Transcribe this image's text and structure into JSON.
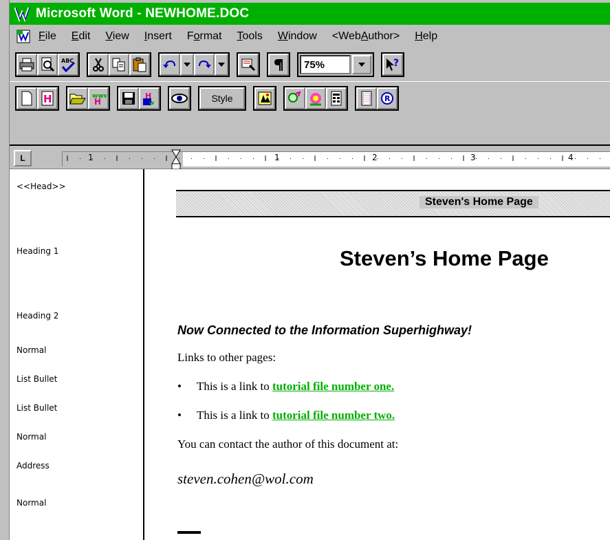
{
  "window": {
    "title": "Microsoft Word - NEWHOME.DOC",
    "title_color": "#00b000"
  },
  "menu": {
    "items": [
      {
        "prefix": "",
        "u": "F",
        "rest": "ile"
      },
      {
        "prefix": "",
        "u": "E",
        "rest": "dit"
      },
      {
        "prefix": "",
        "u": "V",
        "rest": "iew"
      },
      {
        "prefix": "",
        "u": "I",
        "rest": "nsert"
      },
      {
        "prefix": "F",
        "u": "o",
        "rest": "rmat"
      },
      {
        "prefix": "",
        "u": "T",
        "rest": "ools"
      },
      {
        "prefix": "",
        "u": "W",
        "rest": "indow"
      },
      {
        "prefix": "<Web",
        "u": "A",
        "rest": "uthor>"
      },
      {
        "prefix": "",
        "u": "H",
        "rest": "elp"
      }
    ]
  },
  "toolbar": {
    "zoom_value": "75%",
    "style_label": "Style",
    "icons": [
      "print-icon",
      "print-preview-icon",
      "spelling-icon",
      "cut-icon",
      "copy-icon",
      "paste-icon",
      "undo-icon",
      "redo-icon",
      "format-painter-icon",
      "show-paragraph-icon",
      "help-pointer-icon",
      "new-document-icon",
      "new-html-icon",
      "open-icon",
      "open-url-icon",
      "save-icon",
      "save-html-icon",
      "preview-browser-icon",
      "style-icon",
      "insert-image-icon",
      "insert-link-icon",
      "insert-graphic-icon",
      "insert-form-icon",
      "insert-table-icon",
      "insert-registered-icon"
    ]
  },
  "ruler": {
    "tab_selector": "L",
    "numbers": [
      "1",
      "1",
      "2",
      "3",
      "4"
    ]
  },
  "styles": {
    "head": "<<Head>>",
    "heading1": "Heading 1",
    "heading2": "Heading 2",
    "normal1": "Normal",
    "list1": "List Bullet",
    "list2": "List Bullet",
    "normal2": "Normal",
    "address": "Address",
    "normal3": "Normal"
  },
  "document": {
    "head_title": "Steven's Home Page",
    "heading1": "Steven’s Home Page",
    "heading2": "Now Connected to the Information Superhighway!",
    "links_intro": "Links to other pages:",
    "bullet1_prefix": "This is a link to ",
    "bullet1_link": "tutorial file number one.",
    "bullet2_prefix": "This is a link to ",
    "bullet2_link": "tutorial file number two.",
    "contact": "You can contact the author of this document at:",
    "email": "steven.cohen@wol.com",
    "link_color": "#00b000"
  }
}
